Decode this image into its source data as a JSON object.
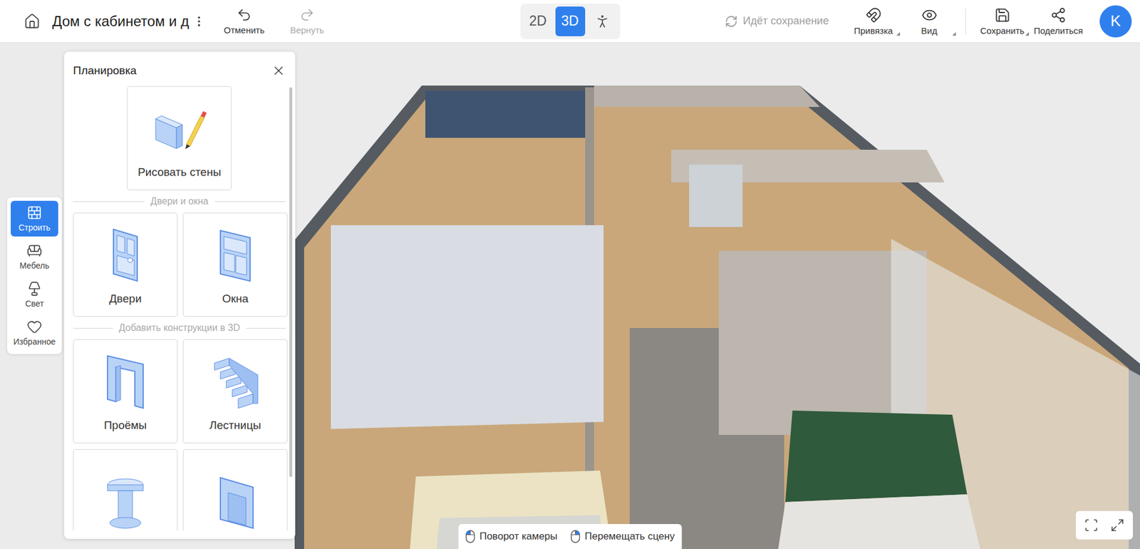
{
  "toolbar": {
    "title": "Дом с кабинетом и д",
    "history": [
      {
        "label": "Отменить",
        "kind": "undo",
        "disabled": false
      },
      {
        "label": "Вернуть",
        "kind": "redo",
        "disabled": true
      }
    ],
    "view_modes": [
      {
        "label": "2D",
        "kind": "text",
        "selected": false
      },
      {
        "label": "3D",
        "kind": "text",
        "selected": true
      },
      {
        "kind": "walk",
        "selected": false
      }
    ],
    "status": "Идёт сохранение",
    "actions": [
      {
        "label": "Привязка",
        "kind": "magnet",
        "dropdown": true
      },
      {
        "label": "Вид",
        "kind": "eye",
        "dropdown": true
      },
      {
        "label": "Сохранить",
        "kind": "save",
        "dropdown": true
      },
      {
        "label": "Поделиться",
        "kind": "share",
        "dropdown": false
      }
    ],
    "avatar": "K"
  },
  "sidebar": {
    "items": [
      {
        "label": "Строить",
        "kind": "build",
        "selected": true
      },
      {
        "label": "Мебель",
        "kind": "furniture",
        "selected": false
      },
      {
        "label": "Свет",
        "kind": "light",
        "selected": false
      },
      {
        "label": "Избранное",
        "kind": "favorite",
        "selected": false
      }
    ]
  },
  "panel": {
    "title": "Планировка",
    "scrollbar_level": 0.88,
    "primary": {
      "label": "Рисовать стены",
      "kind": "walls"
    },
    "sections": [
      {
        "title": "Двери и окна",
        "items": [
          {
            "label": "Двери",
            "kind": "door"
          },
          {
            "label": "Окна",
            "kind": "window"
          }
        ]
      },
      {
        "title": "Добавить конструкции в 3D",
        "items": [
          {
            "label": "Проёмы",
            "kind": "opening"
          },
          {
            "label": "Лестницы",
            "kind": "stairs"
          },
          {
            "kind": "column"
          },
          {
            "kind": "niche"
          }
        ]
      }
    ]
  },
  "hints": [
    {
      "label": "Поворот камеры",
      "kind": "left"
    },
    {
      "label": "Перемещать сцену",
      "kind": "right"
    }
  ]
}
